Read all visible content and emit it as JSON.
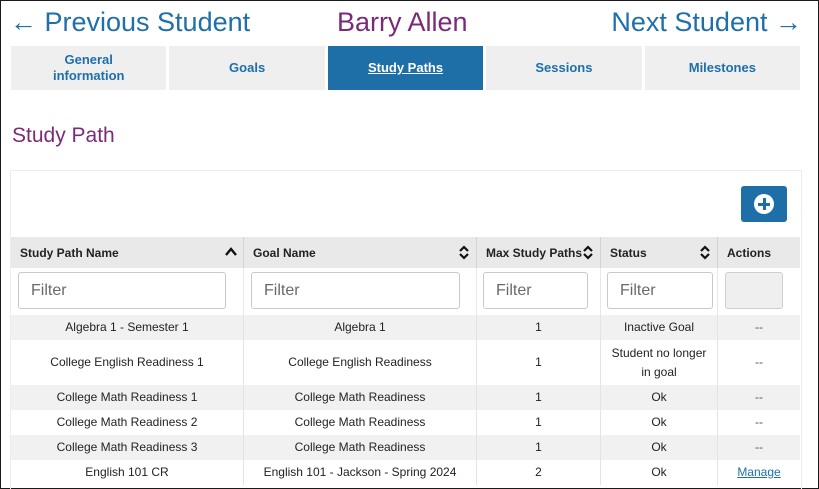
{
  "nav": {
    "prev_label": "← Previous Student",
    "student_name": "Barry Allen",
    "next_label": "Next Student →"
  },
  "tabs": [
    {
      "label_line1": "General",
      "label_line2": "information",
      "active": false
    },
    {
      "label": "Goals",
      "active": false
    },
    {
      "label": "Study Paths",
      "active": true
    },
    {
      "label": "Sessions",
      "active": false
    },
    {
      "label": "Milestones",
      "active": false
    }
  ],
  "section_title": "Study Path",
  "add_button_icon": "plus-circle-icon",
  "table": {
    "columns": [
      {
        "label": "Study Path Name",
        "sort": "ascending"
      },
      {
        "label": "Goal Name",
        "sort": "none"
      },
      {
        "label": "Max Study Paths",
        "sort": "none"
      },
      {
        "label": "Status",
        "sort": "none"
      },
      {
        "label": "Actions"
      }
    ],
    "filter_placeholder": "Filter",
    "rows": [
      {
        "study_path": "Algebra 1 - Semester 1",
        "goal": "Algebra 1",
        "max": "1",
        "status": "Inactive Goal",
        "action": "--"
      },
      {
        "study_path": "College English Readiness 1",
        "goal": "College English Readiness",
        "max": "1",
        "status_line1": "Student no longer",
        "status_line2": "in goal",
        "action": "--"
      },
      {
        "study_path": "College Math Readiness 1",
        "goal": "College Math Readiness",
        "max": "1",
        "status": "Ok",
        "action": "--"
      },
      {
        "study_path": "College Math Readiness 2",
        "goal": "College Math Readiness",
        "max": "1",
        "status": "Ok",
        "action": "--"
      },
      {
        "study_path": "College Math Readiness 3",
        "goal": "College Math Readiness",
        "max": "1",
        "status": "Ok",
        "action": "--"
      },
      {
        "study_path": "English 101 CR",
        "goal": "English 101 - Jackson - Spring 2024",
        "max": "2",
        "status": "Ok",
        "action": "Manage"
      }
    ]
  },
  "colors": {
    "link_blue": "#1f6fa8",
    "active_tab": "#1e6fa8",
    "title_purple": "#7b2a78"
  }
}
